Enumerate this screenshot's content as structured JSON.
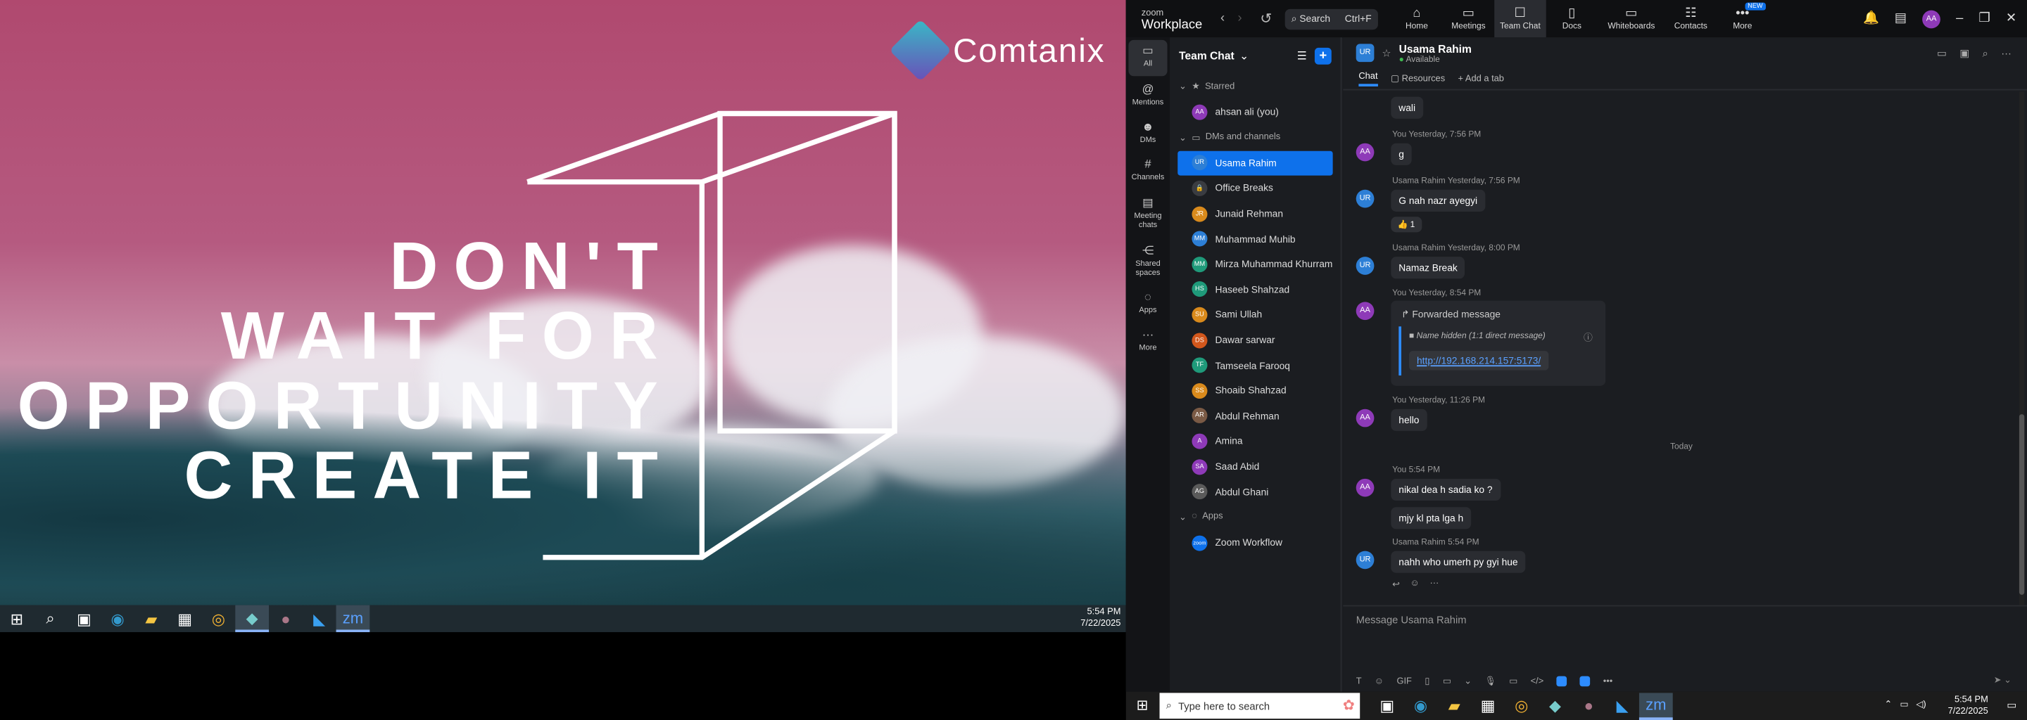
{
  "wallpaper": {
    "brand": "Comtanix",
    "motto": [
      "DON'T",
      "WAIT FOR",
      "OPPORTUNITY",
      "CREATE IT"
    ]
  },
  "left_taskbar": {
    "time": "5:54 PM",
    "date": "7/22/2025"
  },
  "zoom": {
    "brand_small": "zoom",
    "brand_big": "Workplace",
    "search_label": "Search",
    "search_shortcut": "Ctrl+F",
    "nav": [
      {
        "label": "Home",
        "icon": "home-icon"
      },
      {
        "label": "Meetings",
        "icon": "video-icon"
      },
      {
        "label": "Team Chat",
        "icon": "chat-icon"
      },
      {
        "label": "Docs",
        "icon": "doc-icon"
      },
      {
        "label": "Whiteboards",
        "icon": "whiteboard-icon"
      },
      {
        "label": "Contacts",
        "icon": "contacts-icon"
      },
      {
        "label": "More",
        "icon": "more-icon"
      }
    ],
    "new_badge": "NEW",
    "user_initials": "AA",
    "rail": [
      {
        "label": "All"
      },
      {
        "label": "Mentions"
      },
      {
        "label": "DMs"
      },
      {
        "label": "Channels"
      },
      {
        "label": "Meeting chats"
      },
      {
        "label": "Shared spaces"
      },
      {
        "label": "Apps"
      },
      {
        "label": "More"
      }
    ],
    "list_title": "Team Chat",
    "sections": {
      "starred": "Starred",
      "dms": "DMs and channels",
      "apps": "Apps"
    },
    "starred": [
      {
        "name": "ahsan ali (you)",
        "initials": "AA",
        "color": "#8e3ab8"
      }
    ],
    "contacts": [
      {
        "name": "Usama Rahim",
        "initials": "UR",
        "color": "#2d7fd6"
      },
      {
        "name": "Office Breaks",
        "initials": "",
        "color": "#3a3c41"
      },
      {
        "name": "Junaid Rehman",
        "initials": "JR",
        "color": "#d98a1c"
      },
      {
        "name": "Muhammad Muhib",
        "initials": "MM",
        "color": "#2d7fd6"
      },
      {
        "name": "Mirza Muhammad Khurram",
        "initials": "MM",
        "color": "#1f9a7a"
      },
      {
        "name": "Haseeb Shahzad",
        "initials": "HS",
        "color": "#1f9a7a"
      },
      {
        "name": "Sami Ullah",
        "initials": "SU",
        "color": "#d98a1c"
      },
      {
        "name": "Dawar sarwar",
        "initials": "DS",
        "color": "#d2571c"
      },
      {
        "name": "Tamseela Farooq",
        "initials": "TF",
        "color": "#1f9a7a"
      },
      {
        "name": "Shoaib Shahzad",
        "initials": "SS",
        "color": "#d98a1c"
      },
      {
        "name": "Abdul Rehman",
        "initials": "AR",
        "color": "#7a5a45"
      },
      {
        "name": "Amina",
        "initials": "A",
        "color": "#8e3ab8"
      },
      {
        "name": "Saad Abid",
        "initials": "SA",
        "color": "#8e3ab8"
      },
      {
        "name": "Abdul Ghani",
        "initials": "AG",
        "color": "#5a5a5a"
      }
    ],
    "apps": [
      {
        "name": "Zoom Workflow",
        "initials": "zoom",
        "color": "#0e71eb"
      }
    ],
    "chat": {
      "name": "Usama Rahim",
      "status": "Available",
      "tabs": [
        "Chat",
        "Resources",
        "Add a tab"
      ],
      "messages": [
        {
          "text": "wali"
        },
        {
          "meta": "You Yesterday, 7:56 PM",
          "initials": "AA",
          "text": "g"
        },
        {
          "meta": "Usama Rahim Yesterday, 7:56 PM",
          "initials": "UR",
          "text": "G nah nazr ayegyi",
          "reaction": "👍 1"
        },
        {
          "meta": "Usama Rahim Yesterday, 8:00 PM",
          "initials": "UR",
          "text": "Namaz Break"
        },
        {
          "meta": "You Yesterday, 8:54 PM",
          "initials": "AA",
          "forward_title": "Forwarded message",
          "forward_sender": "Name hidden (1:1 direct message)",
          "link": "http://192.168.214.157:5173/"
        },
        {
          "meta": "You Yesterday, 11:26 PM",
          "initials": "AA",
          "text": "hello"
        },
        {
          "meta": "You 5:54 PM",
          "initials": "AA",
          "text": "nikal dea h sadia ko ?"
        },
        {
          "text": "mjy kl pta lga h"
        },
        {
          "meta": "Usama Rahim 5:54 PM",
          "initials": "UR",
          "text": "nahh who umerh py gyi hue"
        }
      ],
      "divider": "Today",
      "composer_placeholder": "Message Usama Rahim"
    }
  },
  "right_taskbar": {
    "search_placeholder": "Type here to search",
    "time": "5:54 PM",
    "date": "7/22/2025"
  }
}
